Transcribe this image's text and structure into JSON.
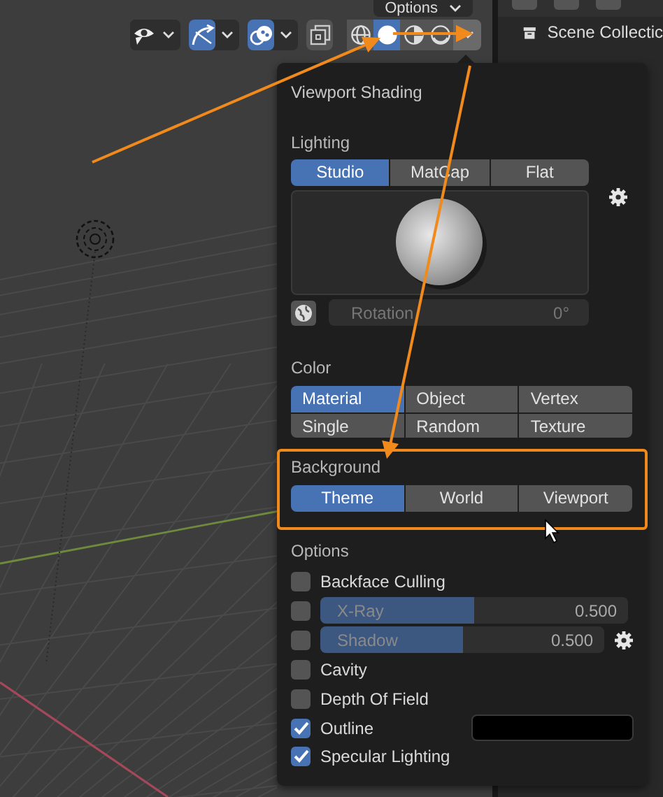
{
  "header": {
    "options_menu": "Options",
    "toolbar": [
      {
        "kind": "visibility",
        "selected": false,
        "dropdown": true
      },
      {
        "kind": "gizmo",
        "selected": true,
        "dropdown": true
      },
      {
        "kind": "overlays",
        "selected": true,
        "dropdown": true
      },
      {
        "kind": "xray",
        "selected": false,
        "dropdown": false
      }
    ],
    "shading_modes": [
      {
        "kind": "wireframe",
        "selected": false
      },
      {
        "kind": "solid",
        "selected": true
      },
      {
        "kind": "material",
        "selected": false
      },
      {
        "kind": "rendered",
        "selected": false
      }
    ]
  },
  "outliner": {
    "items": [
      {
        "label": "Scene Collectic"
      }
    ]
  },
  "popover": {
    "title": "Viewport Shading",
    "lighting": {
      "label": "Lighting",
      "options": [
        {
          "label": "Studio",
          "selected": true
        },
        {
          "label": "MatCap",
          "selected": false
        },
        {
          "label": "Flat",
          "selected": false
        }
      ],
      "rotation_label": "Rotation",
      "rotation_value": "0°"
    },
    "color": {
      "label": "Color",
      "options": [
        {
          "label": "Material",
          "selected": true
        },
        {
          "label": "Object",
          "selected": false
        },
        {
          "label": "Vertex",
          "selected": false
        },
        {
          "label": "Single",
          "selected": false
        },
        {
          "label": "Random",
          "selected": false
        },
        {
          "label": "Texture",
          "selected": false
        }
      ]
    },
    "background": {
      "label": "Background",
      "highlighted": true,
      "options": [
        {
          "label": "Theme",
          "selected": true
        },
        {
          "label": "World",
          "selected": false
        },
        {
          "label": "Viewport",
          "selected": false
        }
      ]
    },
    "options": {
      "label": "Options",
      "items": [
        {
          "kind": "checkbox",
          "label": "Backface Culling",
          "checked": false
        },
        {
          "kind": "slider",
          "label": "X-Ray",
          "value": "0.500",
          "checked": false,
          "level": 0.5,
          "settings": false
        },
        {
          "kind": "slider",
          "label": "Shadow",
          "value": "0.500",
          "checked": false,
          "level": 0.5,
          "settings": true
        },
        {
          "kind": "checkbox",
          "label": "Cavity",
          "checked": false
        },
        {
          "kind": "checkbox",
          "label": "Depth Of Field",
          "checked": false
        },
        {
          "kind": "color",
          "label": "Outline",
          "checked": true,
          "color": "#000000"
        },
        {
          "kind": "checkbox",
          "label": "Specular Lighting",
          "checked": true
        }
      ]
    }
  }
}
